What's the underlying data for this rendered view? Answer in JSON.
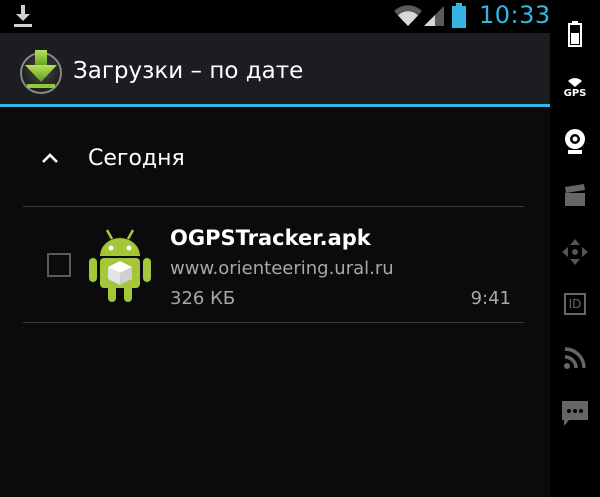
{
  "status_bar": {
    "time": "10:33",
    "accent_color": "#33b5e5"
  },
  "action_bar": {
    "title": "Загрузки – по дате",
    "icon": "download-app-icon"
  },
  "section": {
    "title": "Сегодня",
    "icon": "chevron-up-icon"
  },
  "download_item": {
    "file_name": "OGPSTracker.apk",
    "source": "www.orienteering.ural.ru",
    "size": "326 КБ",
    "time": "9:41",
    "checked": false
  },
  "tray": {
    "gps_label": "GPS",
    "id_label": "ID",
    "icons": [
      "battery-icon",
      "gps-icon",
      "webcam-icon",
      "clapper-icon",
      "dpad-icon",
      "id-icon",
      "rss-icon",
      "chat-icon"
    ]
  }
}
